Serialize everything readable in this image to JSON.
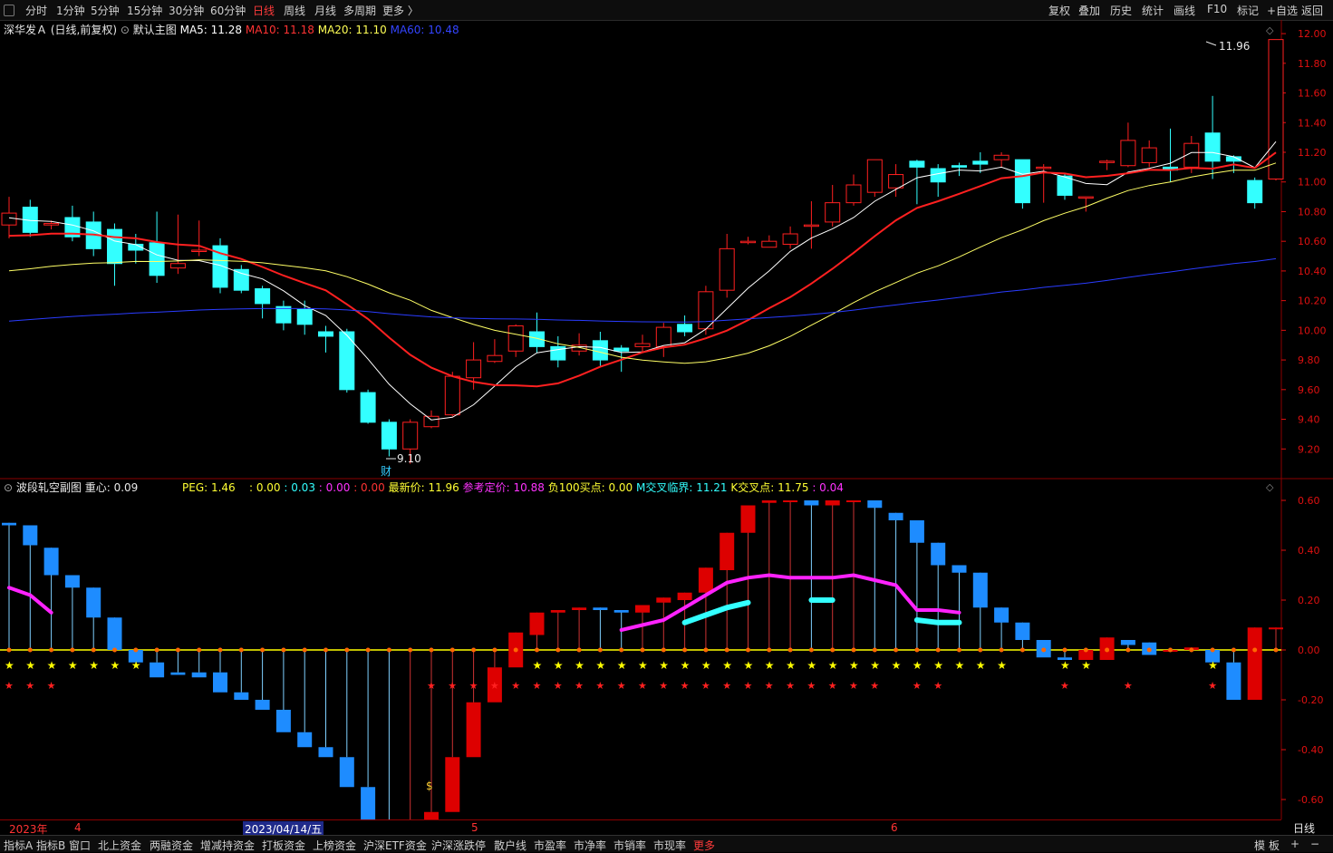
{
  "toolbar": {
    "period_tabs": [
      "分时",
      "1分钟",
      "5分钟",
      "15分钟",
      "30分钟",
      "60分钟",
      "日线",
      "周线",
      "月线",
      "多周期",
      "更多 〉"
    ],
    "active_tab": "日线",
    "right_tools": [
      "复权",
      "叠加",
      "历史",
      "统计",
      "画线",
      "F10",
      "标记",
      "+自选",
      "返回"
    ]
  },
  "main_legend": {
    "stock": "深华发Ａ",
    "mode": "(日线,前复权)",
    "template": "默认主图",
    "ma5": "MA5: 11.28",
    "ma10": "MA10: 11.18",
    "ma20": "MA20: 11.10",
    "ma60": "MA60: 10.48"
  },
  "sub_legend": {
    "name": "波段轧空副图",
    "center": "重心: 0.09",
    "peg": "PEG: 1.46",
    "v1": ": 0.00",
    "v2": ": 0.03",
    "v3": ": 0.00",
    "v4": ": 0.00",
    "latest": "最新价: 11.96",
    "ref": "参考定价: 10.88",
    "buy": "负100买点: 0.00",
    "mcross": "M交叉临界: 11.21",
    "kcross": "K交叉点: 11.75",
    "kval": ": 0.04"
  },
  "annotations": {
    "high": "11.96",
    "low": "9.10",
    "cai": "财"
  },
  "dates": {
    "year": "2023年",
    "m4": "4",
    "cursor": "2023/04/14/五",
    "m5": "5",
    "m6": "6",
    "period": "日线"
  },
  "bottom_tabs": [
    "指标A",
    "指标B",
    "窗口",
    "北上资金",
    "两融资金",
    "增减持资金",
    "打板资金",
    "上榜资金",
    "沪深ETF资金",
    "沪深涨跌停",
    "散户线",
    "市盈率",
    "市净率",
    "市销率",
    "市现率",
    "更多"
  ],
  "bottom_right": [
    "模",
    "板",
    "+",
    "−"
  ],
  "colors": {
    "up": "#ff2020",
    "down": "#33ffff",
    "ma5": "#ffffff",
    "ma10": "#ff2020",
    "ma20": "#ffff66",
    "ma60": "#2a3cff",
    "sub_up": "#dd0000",
    "sub_down": "#1e8cff"
  },
  "chart_data": [
    {
      "type": "candlestick",
      "ylim": [
        9.0,
        12.08
      ],
      "yticks": [
        12.0,
        11.8,
        11.6,
        11.4,
        11.2,
        11.0,
        10.8,
        10.6,
        10.4,
        10.2,
        10.0,
        9.8,
        9.6,
        9.4,
        9.2
      ],
      "candles": [
        [
          10.71,
          10.79,
          10.62,
          10.9
        ],
        [
          10.83,
          10.66,
          10.63,
          10.88
        ],
        [
          10.71,
          10.72,
          10.68,
          10.74
        ],
        [
          10.76,
          10.63,
          10.6,
          10.84
        ],
        [
          10.73,
          10.55,
          10.5,
          10.8
        ],
        [
          10.68,
          10.45,
          10.3,
          10.72
        ],
        [
          10.58,
          10.54,
          10.45,
          10.65
        ],
        [
          10.59,
          10.37,
          10.32,
          10.8
        ],
        [
          10.42,
          10.45,
          10.38,
          10.78
        ],
        [
          10.54,
          10.54,
          10.5,
          10.74
        ],
        [
          10.57,
          10.29,
          10.25,
          10.62
        ],
        [
          10.41,
          10.27,
          10.25,
          10.44
        ],
        [
          10.28,
          10.18,
          10.08,
          10.3
        ],
        [
          10.16,
          10.05,
          10.0,
          10.2
        ],
        [
          10.14,
          10.04,
          9.97,
          10.2
        ],
        [
          9.99,
          9.96,
          9.85,
          10.03
        ],
        [
          9.99,
          9.6,
          9.58,
          10.01
        ],
        [
          9.58,
          9.38,
          9.37,
          9.6
        ],
        [
          9.38,
          9.2,
          9.15,
          9.4
        ],
        [
          9.2,
          9.38,
          9.1,
          9.4
        ],
        [
          9.35,
          9.42,
          9.34,
          9.46
        ],
        [
          9.43,
          9.69,
          9.42,
          9.72
        ],
        [
          9.68,
          9.8,
          9.6,
          9.92
        ],
        [
          9.79,
          9.83,
          9.78,
          9.94
        ],
        [
          9.86,
          10.03,
          9.82,
          10.04
        ],
        [
          9.99,
          9.89,
          9.85,
          10.12
        ],
        [
          9.89,
          9.8,
          9.75,
          9.96
        ],
        [
          9.86,
          9.9,
          9.83,
          9.98
        ],
        [
          9.93,
          9.8,
          9.76,
          9.99
        ],
        [
          9.88,
          9.86,
          9.72,
          9.9
        ],
        [
          9.89,
          9.91,
          9.85,
          9.97
        ],
        [
          9.89,
          10.02,
          9.82,
          10.05
        ],
        [
          10.04,
          9.99,
          9.96,
          10.1
        ],
        [
          10.01,
          10.26,
          9.97,
          10.3
        ],
        [
          10.27,
          10.55,
          10.22,
          10.65
        ],
        [
          10.6,
          10.6,
          10.58,
          10.63
        ],
        [
          10.56,
          10.6,
          10.56,
          10.64
        ],
        [
          10.58,
          10.65,
          10.55,
          10.7
        ],
        [
          10.71,
          10.71,
          10.55,
          10.87
        ],
        [
          10.73,
          10.86,
          10.7,
          10.98
        ],
        [
          10.86,
          10.98,
          10.84,
          11.05
        ],
        [
          10.93,
          11.15,
          10.9,
          11.15
        ],
        [
          10.96,
          11.05,
          10.9,
          11.12
        ],
        [
          11.14,
          11.1,
          10.85,
          11.15
        ],
        [
          11.09,
          11.0,
          10.9,
          11.12
        ],
        [
          11.11,
          11.1,
          11.04,
          11.13
        ],
        [
          11.14,
          11.12,
          11.06,
          11.2
        ],
        [
          11.15,
          11.18,
          11.1,
          11.2
        ],
        [
          11.15,
          10.86,
          10.82,
          11.15
        ],
        [
          11.1,
          11.1,
          10.86,
          11.12
        ],
        [
          11.04,
          10.91,
          10.88,
          11.06
        ],
        [
          10.9,
          10.9,
          10.8,
          10.9
        ],
        [
          11.14,
          11.14,
          11.08,
          11.15
        ],
        [
          11.11,
          11.28,
          11.1,
          11.4
        ],
        [
          11.13,
          11.23,
          11.1,
          11.28
        ],
        [
          11.1,
          11.08,
          11.0,
          11.36
        ],
        [
          11.1,
          11.26,
          11.06,
          11.31
        ],
        [
          11.33,
          11.14,
          11.02,
          11.58
        ],
        [
          11.17,
          11.14,
          11.06,
          11.18
        ],
        [
          11.01,
          10.86,
          10.82,
          11.03
        ],
        [
          11.02,
          11.96,
          11.01,
          11.96
        ]
      ]
    },
    {
      "type": "bar",
      "ylim": [
        -0.68,
        0.64
      ],
      "yticks": [
        0.6,
        0.4,
        0.2,
        0.0,
        -0.2,
        -0.4,
        -0.6
      ],
      "bars": [
        [
          0.51,
          0.5
        ],
        [
          0.5,
          0.42
        ],
        [
          0.41,
          0.3
        ],
        [
          0.3,
          0.25
        ],
        [
          0.25,
          0.13
        ],
        [
          0.13,
          0.0
        ],
        [
          0.0,
          -0.05
        ],
        [
          -0.05,
          -0.11
        ],
        [
          -0.09,
          -0.1
        ],
        [
          -0.09,
          -0.11
        ],
        [
          -0.09,
          -0.17
        ],
        [
          -0.17,
          -0.2
        ],
        [
          -0.2,
          -0.24
        ],
        [
          -0.24,
          -0.33
        ],
        [
          -0.33,
          -0.39
        ],
        [
          -0.39,
          -0.43
        ],
        [
          -0.43,
          -0.55
        ],
        [
          -0.55,
          -0.71
        ],
        [
          -0.71,
          -0.82
        ],
        [
          -0.82,
          -0.77
        ],
        [
          -0.76,
          -0.65
        ],
        [
          -0.65,
          -0.43
        ],
        [
          -0.43,
          -0.21
        ],
        [
          -0.21,
          -0.07
        ],
        [
          -0.07,
          0.07
        ],
        [
          0.06,
          0.15
        ],
        [
          0.15,
          0.16
        ],
        [
          0.16,
          0.17
        ],
        [
          0.17,
          0.16
        ],
        [
          0.16,
          0.15
        ],
        [
          0.15,
          0.18
        ],
        [
          0.19,
          0.21
        ],
        [
          0.2,
          0.23
        ],
        [
          0.23,
          0.33
        ],
        [
          0.32,
          0.47
        ],
        [
          0.47,
          0.58
        ],
        [
          0.59,
          0.6
        ],
        [
          0.6,
          0.6
        ],
        [
          0.6,
          0.58
        ],
        [
          0.58,
          0.6
        ],
        [
          0.6,
          0.6
        ],
        [
          0.6,
          0.57
        ],
        [
          0.55,
          0.52
        ],
        [
          0.52,
          0.43
        ],
        [
          0.43,
          0.34
        ],
        [
          0.34,
          0.31
        ],
        [
          0.31,
          0.17
        ],
        [
          0.17,
          0.11
        ],
        [
          0.11,
          0.04
        ],
        [
          0.04,
          -0.03
        ],
        [
          -0.03,
          -0.04
        ],
        [
          -0.04,
          0.0
        ],
        [
          -0.04,
          0.05
        ],
        [
          0.04,
          0.02
        ],
        [
          0.03,
          -0.02
        ],
        [
          0.0,
          0.0
        ],
        [
          0.0,
          0.01
        ],
        [
          0.0,
          -0.05
        ],
        [
          -0.05,
          -0.2
        ],
        [
          -0.2,
          0.09
        ],
        [
          0.09,
          0.09
        ]
      ],
      "magenta_line": [
        [
          0,
          0.25
        ],
        [
          1,
          0.22
        ],
        [
          2,
          0.15
        ],
        [
          29,
          0.08
        ],
        [
          30,
          0.1
        ],
        [
          31,
          0.12
        ],
        [
          32,
          0.17
        ],
        [
          33,
          0.22
        ],
        [
          34,
          0.27
        ],
        [
          35,
          0.29
        ],
        [
          36,
          0.3
        ],
        [
          37,
          0.29
        ],
        [
          38,
          0.29
        ],
        [
          39,
          0.29
        ],
        [
          40,
          0.3
        ],
        [
          41,
          0.28
        ],
        [
          42,
          0.26
        ],
        [
          43,
          0.16
        ],
        [
          44,
          0.16
        ],
        [
          45,
          0.15
        ]
      ],
      "cyan_line": [
        [
          32,
          0.11
        ],
        [
          33,
          0.14
        ],
        [
          34,
          0.17
        ],
        [
          35,
          0.19
        ],
        [
          38,
          0.2
        ],
        [
          39,
          0.2
        ],
        [
          43,
          0.12
        ],
        [
          44,
          0.11
        ],
        [
          45,
          0.11
        ]
      ]
    }
  ]
}
